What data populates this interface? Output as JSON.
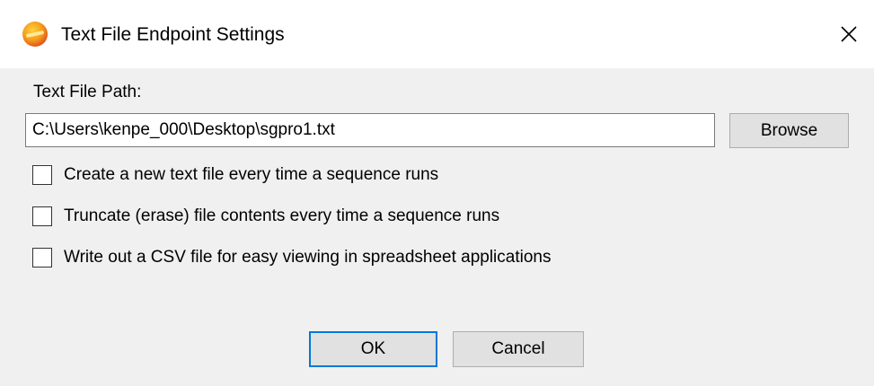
{
  "window": {
    "title": "Text File Endpoint Settings",
    "icon": "sgpro-app-icon",
    "close_icon": "close-icon"
  },
  "path": {
    "label": "Text File Path:",
    "value": "C:\\Users\\kenpe_000\\Desktop\\sgpro1.txt",
    "browse_label": "Browse"
  },
  "options": [
    {
      "label": "Create a new text file every time a sequence runs",
      "checked": false
    },
    {
      "label": "Truncate (erase) file contents every time a sequence runs",
      "checked": false
    },
    {
      "label": "Write out a CSV file for easy viewing in spreadsheet applications",
      "checked": false
    }
  ],
  "buttons": {
    "ok_label": "OK",
    "cancel_label": "Cancel"
  },
  "colors": {
    "titlebar": "#ffffff",
    "dialog_bg": "#f0f0f0",
    "button_bg": "#e1e1e1",
    "focus_border": "#0078d7"
  }
}
